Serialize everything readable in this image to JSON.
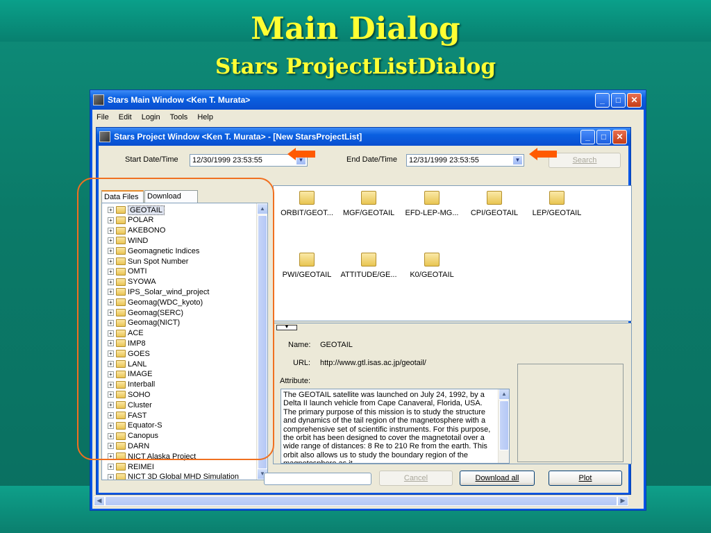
{
  "slide": {
    "title": "Main Dialog",
    "subtitle": "Stars ProjectListDialog"
  },
  "main_window": {
    "title": "Stars Main Window <Ken T. Murata>",
    "menu": [
      "File",
      "Edit",
      "Login",
      "Tools",
      "Help"
    ]
  },
  "project_window": {
    "title": "Stars Project Window <Ken T. Murata> - [New StarsProjectList]",
    "start_label": "Start Date/Time",
    "start_value": "12/30/1999 23:53:55",
    "end_label": "End Date/Time",
    "end_value": "12/31/1999 23:53:55",
    "search_label": "Search",
    "tabs": [
      "Data Files",
      "Download List"
    ],
    "tree": [
      "GEOTAIL",
      "POLAR",
      "AKEBONO",
      "WIND",
      "Geomagnetic Indices",
      "Sun Spot Number",
      "OMTI",
      "SYOWA",
      "IPS_Solar_wind_project",
      "Geomag(WDC_kyoto)",
      "Geomag(SERC)",
      "Geomag(NICT)",
      "ACE",
      "IMP8",
      "GOES",
      "LANL",
      "IMAGE",
      "Interball",
      "SOHO",
      "Cluster",
      "FAST",
      "Equator-S",
      "Canopus",
      "DARN",
      "NICT Alaska Project",
      "REIMEI",
      "NICT 3D Global MHD Simulation"
    ],
    "files": [
      "ORBIT/GEOT...",
      "MGF/GEOTAIL",
      "EFD-LEP-MG...",
      "CPI/GEOTAIL",
      "LEP/GEOTAIL",
      "PWI/GEOTAIL",
      "ATTITUDE/GE...",
      "K0/GEOTAIL"
    ],
    "detail": {
      "name_label": "Name:",
      "name_value": "GEOTAIL",
      "url_label": "URL:",
      "url_value": "http://www.gtl.isas.ac.jp/geotail/",
      "attribute_label": "Attribute:",
      "attribute_text": "The GEOTAIL satellite was launched on July 24, 1992, by a Delta II launch vehicle from Cape Canaveral, Florida, USA. The primary purpose of this mission is to study the structure and dynamics of the tail region of the magnetosphere with a comprehensive set of scientific instruments. For this purpose, the orbit has been designed to cover the magnetotail over a wide range of distances: 8 Re to 210 Re from the earth. This orbit also allows us to study the boundary region of the magnetosphere as it"
    },
    "buttons": {
      "cancel": "Cancel",
      "download_all": "Download all",
      "plot": "Plot"
    }
  },
  "icons": {
    "start_dropdown": "chevron-down-icon",
    "end_dropdown": "chevron-down-icon",
    "folder": "folder-icon"
  },
  "colors": {
    "title_text": "#ffff33",
    "slide_bg": "#0b7a6a",
    "xp_titlebar": "#0a5fe0",
    "highlight": "#f07020"
  }
}
